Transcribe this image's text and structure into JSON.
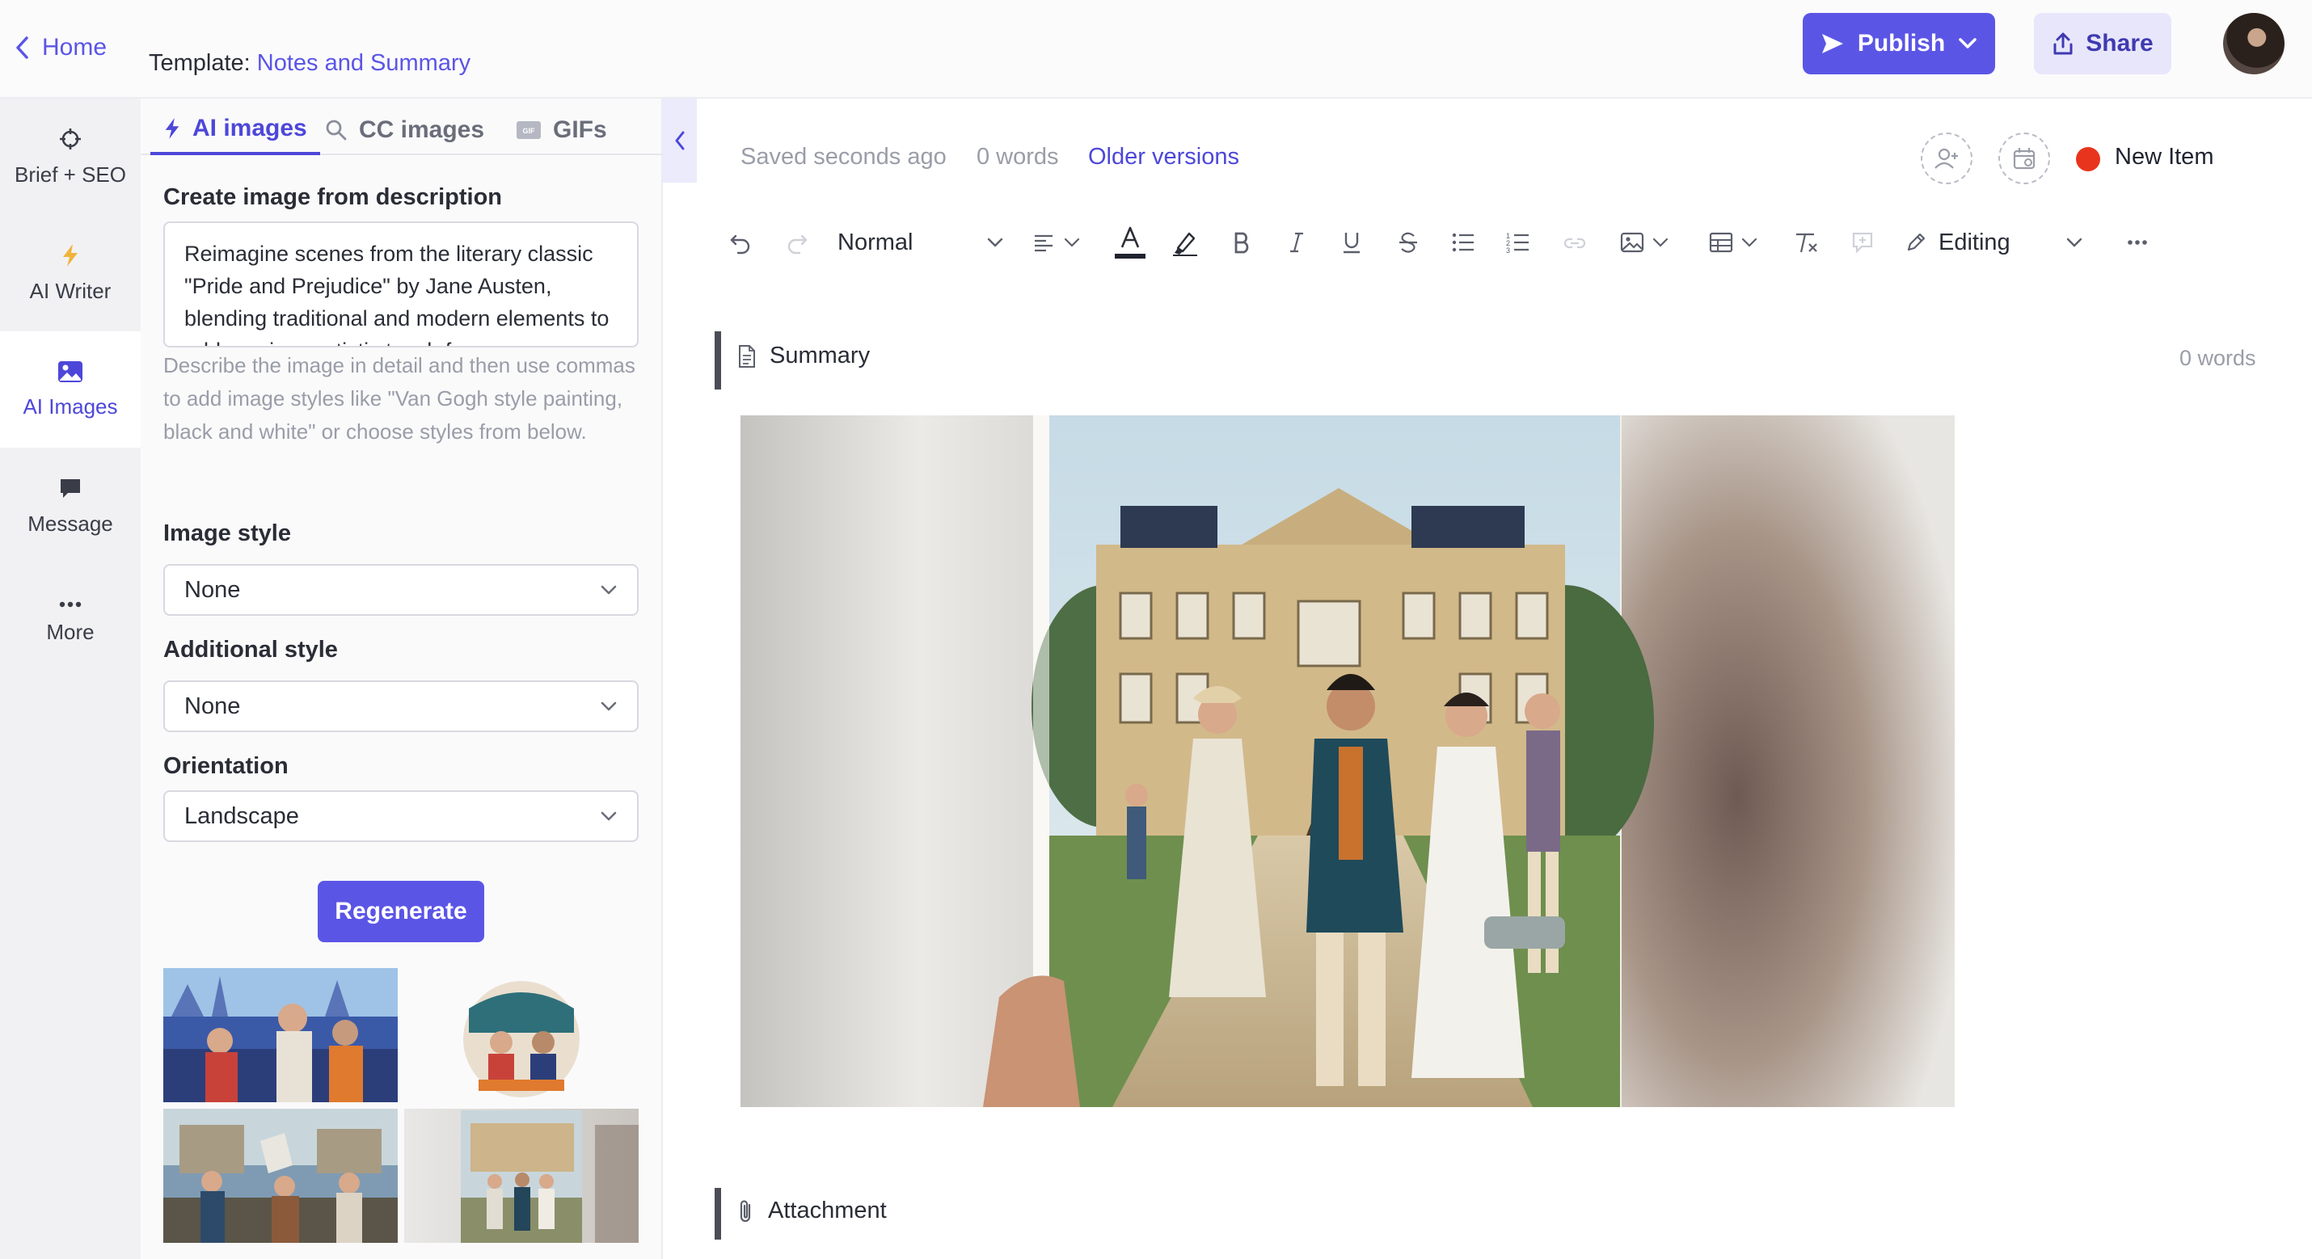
{
  "header": {
    "home_label": "Home",
    "template_prefix": "Template:",
    "template_name": "Notes and Summary",
    "publish_label": "Publish",
    "share_label": "Share"
  },
  "nav": {
    "items": [
      {
        "label": "Brief + SEO",
        "icon": "crosshair-icon"
      },
      {
        "label": "AI Writer",
        "icon": "lightning-icon"
      },
      {
        "label": "AI Images",
        "icon": "image-icon",
        "active": true
      },
      {
        "label": "Message",
        "icon": "chat-bubble-icon"
      },
      {
        "label": "More",
        "icon": "ellipsis-icon"
      }
    ]
  },
  "panel": {
    "tabs": [
      {
        "label": "AI images",
        "icon": "lightning-icon",
        "active": true
      },
      {
        "label": "CC images",
        "icon": "search-icon"
      },
      {
        "label": "GIFs",
        "icon": "gif-icon"
      }
    ],
    "description_label": "Create image from description",
    "description_value": "Reimagine scenes from the literary classic \"Pride and Prejudice\" by Jane Austen, blending traditional and modern elements to add a unique artistic touch for a",
    "description_help": "Describe the image in detail and then use commas to add image styles like \"Van Gogh style painting, black and white\" or choose styles from below.",
    "image_style_label": "Image style",
    "image_style_value": "None",
    "additional_style_label": "Additional style",
    "additional_style_value": "None",
    "orientation_label": "Orientation",
    "orientation_value": "Landscape",
    "regenerate_label": "Regenerate"
  },
  "editor": {
    "saved_status": "Saved seconds ago",
    "word_count": "0 words",
    "older_versions": "Older versions",
    "status_label": "New Item",
    "status_color": "#e8341c",
    "toolbar": {
      "paragraph_style": "Normal",
      "mode_label": "Editing"
    },
    "sections": [
      {
        "title": "Summary",
        "icon": "document-icon",
        "word_count": "0 words"
      },
      {
        "title": "Attachment",
        "icon": "paperclip-icon"
      }
    ]
  },
  "colors": {
    "accent": "#5b55e6",
    "accent_light": "#e8e6fb",
    "nav_bg": "#f1f1f4"
  }
}
